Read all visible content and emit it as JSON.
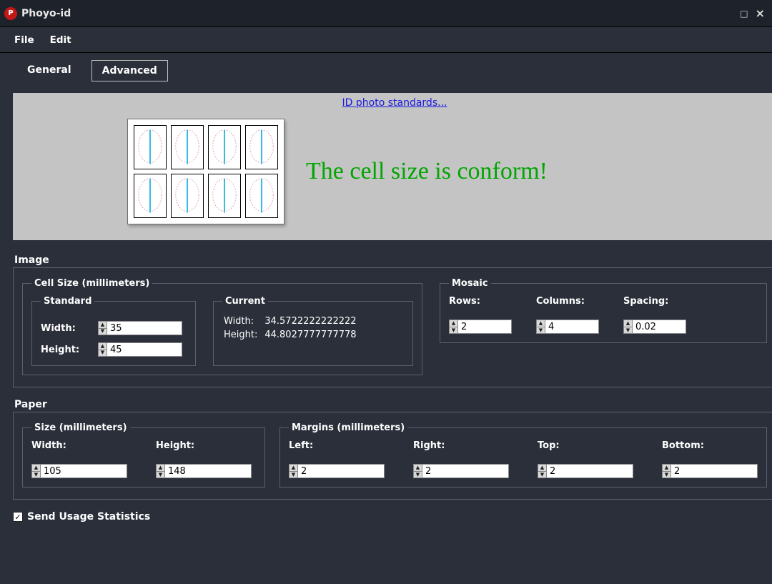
{
  "window": {
    "title": "Phoyo-id"
  },
  "menu": {
    "file": "File",
    "edit": "Edit"
  },
  "tabs": {
    "general": "General",
    "advanced": "Advanced"
  },
  "preview": {
    "link": "ID photo standards...",
    "message": "The cell size is conform!",
    "rows": 2,
    "cols": 4
  },
  "image": {
    "section": "Image",
    "cell_size": {
      "legend": "Cell Size (millimeters)",
      "standard": {
        "legend": "Standard",
        "width_label": "Width:",
        "height_label": "Height:",
        "width": "35",
        "height": "45"
      },
      "current": {
        "legend": "Current",
        "width_label": "Width:",
        "height_label": "Height:",
        "width": "34.5722222222222",
        "height": "44.8027777777778"
      }
    },
    "mosaic": {
      "legend": "Mosaic",
      "rows_label": "Rows:",
      "cols_label": "Columns:",
      "spacing_label": "Spacing:",
      "rows": "2",
      "cols": "4",
      "spacing": "0.02"
    }
  },
  "paper": {
    "section": "Paper",
    "size": {
      "legend": "Size (millimeters)",
      "width_label": "Width:",
      "height_label": "Height:",
      "width": "105",
      "height": "148"
    },
    "margins": {
      "legend": "Margins (millimeters)",
      "left_label": "Left:",
      "right_label": "Right:",
      "top_label": "Top:",
      "bottom_label": "Bottom:",
      "left": "2",
      "right": "2",
      "top": "2",
      "bottom": "2"
    }
  },
  "footer": {
    "send_stats": "Send Usage Statistics"
  }
}
